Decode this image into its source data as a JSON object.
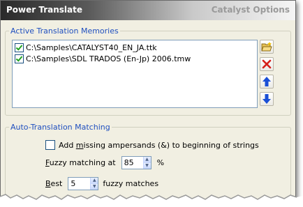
{
  "window": {
    "title": "Power Translate",
    "subtitle": "Catalyst Options"
  },
  "memories": {
    "group_label": "Active Translation Memories",
    "items": [
      {
        "path": "C:\\Samples\\CATALYST40_EN_JA.ttk",
        "checked": true
      },
      {
        "path": "C:\\Samples\\SDL TRADOS (En-Jp) 2006.tmw",
        "checked": true
      }
    ],
    "buttons": [
      {
        "icon": "open-folder-icon"
      },
      {
        "icon": "delete-icon"
      },
      {
        "icon": "move-up-icon"
      },
      {
        "icon": "move-down-icon"
      }
    ]
  },
  "matching": {
    "group_label": "Auto-Translation Matching",
    "ampersand": {
      "checked": false,
      "label_pre": "Add ",
      "label_ul": "m",
      "label_post": "issing ampersands (&) to beginning of strings"
    },
    "fuzzy": {
      "label_ul": "F",
      "label_post": "uzzy matching at",
      "value": "85",
      "unit": "%"
    },
    "best": {
      "label_ul": "B",
      "label_post": "est",
      "value": "5",
      "suffix": "fuzzy matches"
    }
  },
  "colors": {
    "group_label": "#1f4fbf",
    "panel": "#f1efe2",
    "delete_icon": "#d6201a",
    "arrow_icon": "#1a4fd6"
  }
}
